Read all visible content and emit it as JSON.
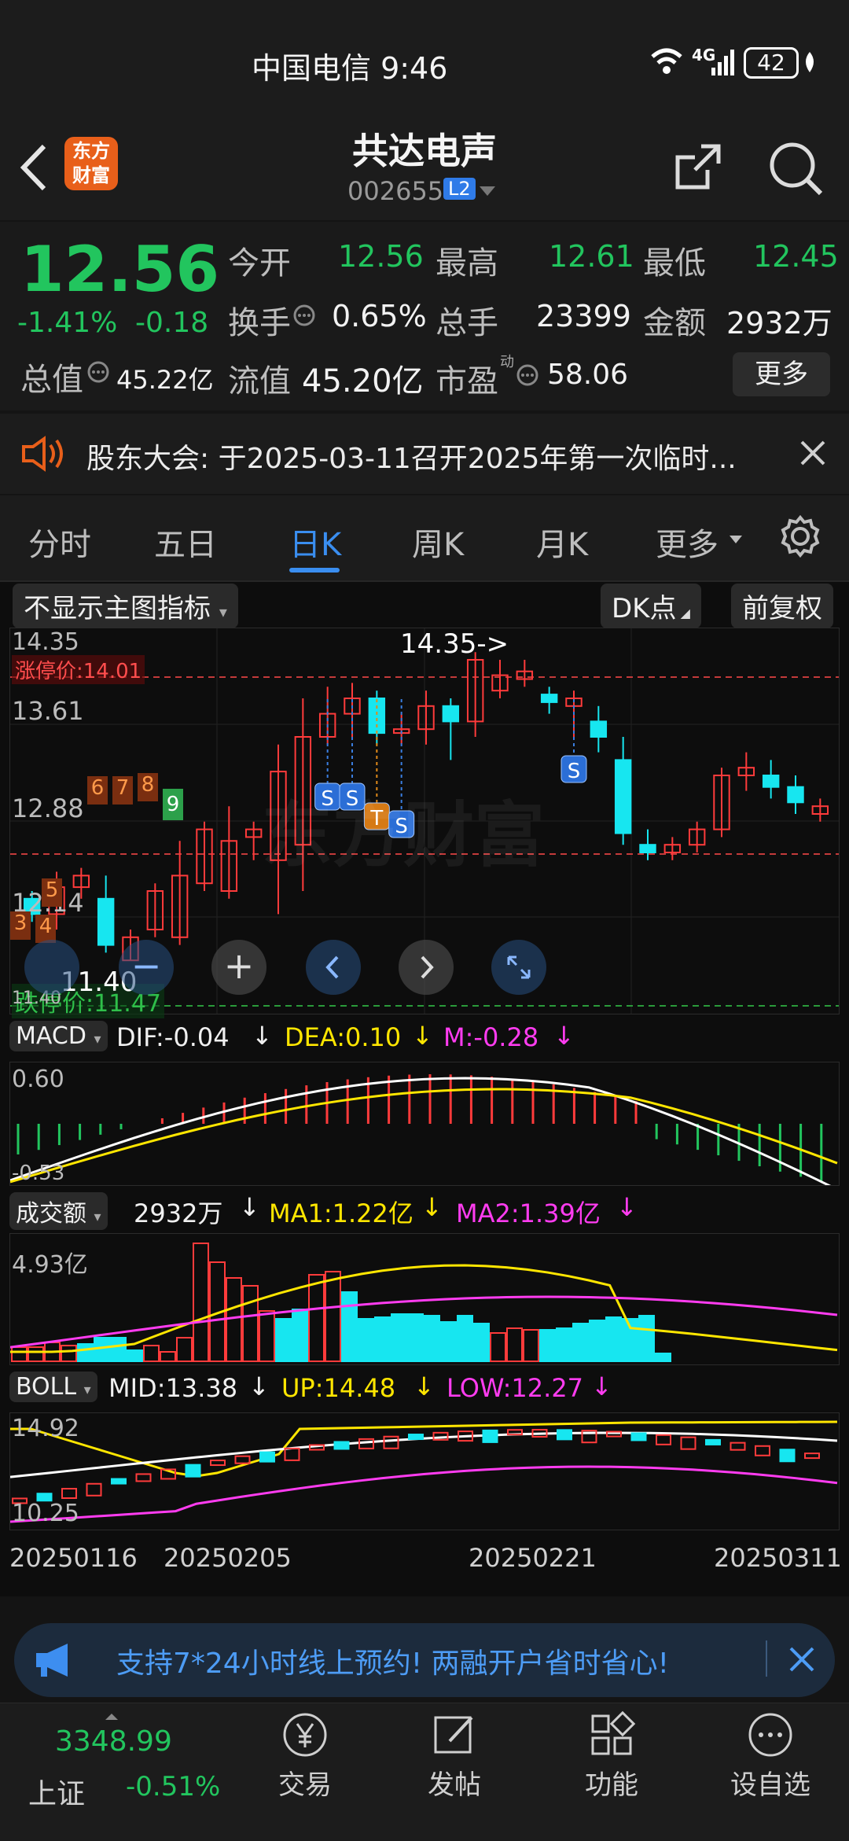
{
  "status": {
    "carrier_time": "中国电信 9:46",
    "network": "4G",
    "battery": "42"
  },
  "header": {
    "logo_line1": "东方",
    "logo_line2": "财富",
    "title": "共达电声",
    "code": "002655",
    "level": "L2"
  },
  "quote": {
    "price": "12.56",
    "change_pct": "-1.41%",
    "change": "-0.18",
    "open_label": "今开",
    "open": "12.56",
    "high_label": "最高",
    "high": "12.61",
    "low_label": "最低",
    "low": "12.45",
    "turnover_label": "换手",
    "turnover": "0.65%",
    "volume_label": "总手",
    "volume": "23399",
    "amount_label": "金额",
    "amount": "2932万",
    "mktcap_label": "总值",
    "mktcap": "45.22亿",
    "float_label": "流值",
    "float": "45.20亿",
    "pe_label": "市盈",
    "pe_sup": "动",
    "pe": "58.06",
    "more_label": "更多"
  },
  "notice": {
    "text": "股东大会: 于2025-03-11召开2025年第一次临时..."
  },
  "tabs": {
    "t1": "分时",
    "t2": "五日",
    "t3": "日K",
    "t4": "周K",
    "t5": "月K",
    "t6": "更多"
  },
  "controls": {
    "indicator": "不显示主图指标",
    "dk": "DK点",
    "fq": "前复权"
  },
  "main_chart": {
    "y_top": "14.35",
    "limit_up": "涨停价:14.01",
    "y_2": "13.61",
    "y_3": "12.88",
    "y_4": "12.14",
    "y_bottom": "11.40",
    "limit_down": "跌停价:11.47",
    "high_marker": "14.35->",
    "low_marker": "11.40",
    "watermark": "东方财富",
    "nines": [
      "3",
      "4",
      "5",
      "6",
      "7",
      "8",
      "9"
    ]
  },
  "macd": {
    "name": "MACD",
    "dif": "DIF:-0.04",
    "dea": "DEA:0.10",
    "m": "M:-0.28",
    "y_top": "0.60",
    "y_bottom": "-0.53"
  },
  "vol": {
    "name": "成交额",
    "v": "2932万",
    "ma1": "MA1:1.22亿",
    "ma2": "MA2:1.39亿",
    "y_top": "4.93亿"
  },
  "boll": {
    "name": "BOLL",
    "mid": "MID:13.38",
    "up": "UP:14.48",
    "low": "LOW:12.27",
    "y_top": "14.92",
    "y_bottom": "10.25"
  },
  "dates": {
    "d1": "20250116",
    "d2": "20250205",
    "d3": "20250221",
    "d4": "20250311"
  },
  "banner": {
    "text": "支持7*24小时线上预约! 两融开户省时省心!"
  },
  "nav": {
    "index_value": "3348.99",
    "index_name": "上证",
    "index_pct": "-0.51%",
    "n1": "交易",
    "n2": "发帖",
    "n3": "功能",
    "n4": "设自选"
  },
  "colors": {
    "up": "#ff3b3b",
    "down": "#17e6f0",
    "accent_green": "#22c55e",
    "yellow": "#ffe600",
    "magenta": "#ff3cf0",
    "orange": "#e85f1a"
  }
}
